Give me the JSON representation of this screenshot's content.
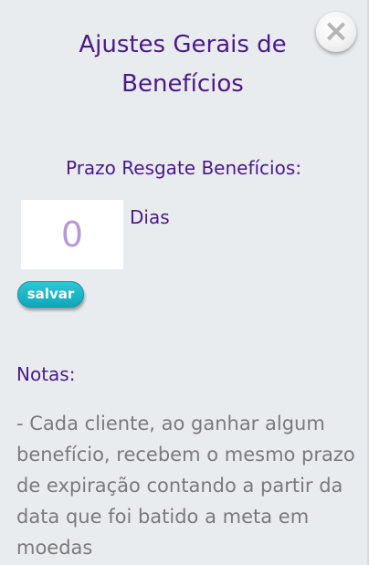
{
  "dialog": {
    "title": "Ajustes Gerais de Benefícios",
    "close_icon": "close-icon"
  },
  "settings": {
    "section_label": "Prazo Resgate Benefícios:",
    "days_value": "0",
    "days_unit": "Dias",
    "save_label": "salvar"
  },
  "notes": {
    "heading": "Notas:",
    "text": "- Cada cliente, ao ganhar algum benefício, recebem o mesmo prazo de expiração contando a partir da data que foi batido a meta em moedas"
  },
  "colors": {
    "panel_bg": "#e9ecef",
    "accent_purple": "#4a1a87",
    "save_button": "#1ab4c6",
    "notes_text": "#7a7a7a"
  }
}
